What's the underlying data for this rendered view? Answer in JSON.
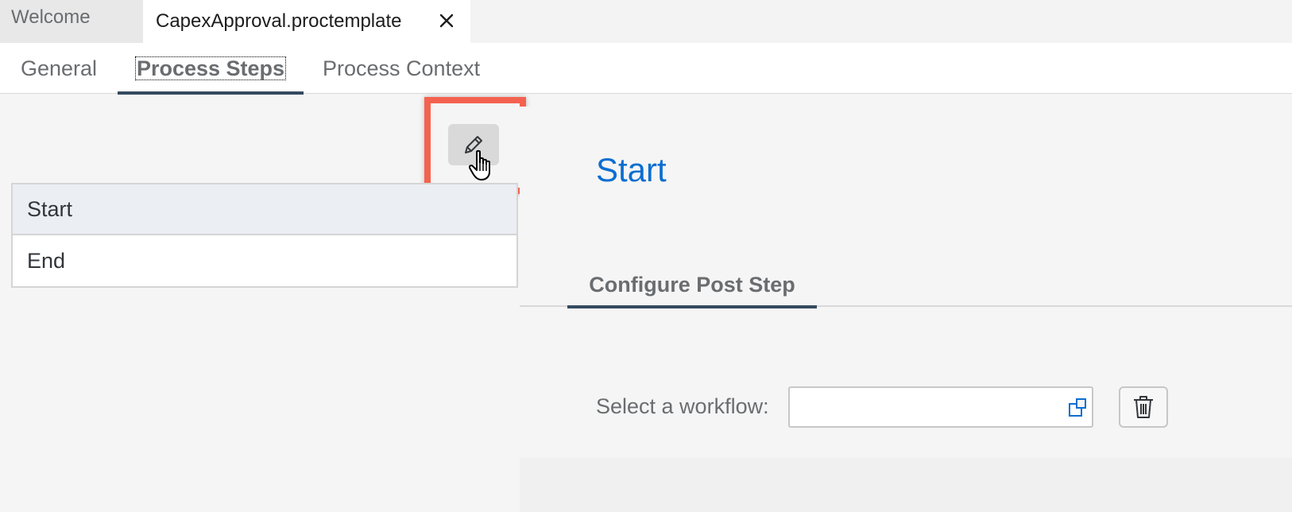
{
  "editor_tabs": [
    {
      "label": "Welcome",
      "active": false
    },
    {
      "label": "CapexApproval.proctemplate",
      "active": true
    }
  ],
  "sub_tabs": {
    "general": "General",
    "process_steps": "Process Steps",
    "process_context": "Process Context",
    "selected": "Process Steps"
  },
  "steps": [
    {
      "label": "Start",
      "selected": true
    },
    {
      "label": "End",
      "selected": false
    }
  ],
  "detail": {
    "title": "Start",
    "tab": "Configure Post Step",
    "workflow_label": "Select a workflow:",
    "workflow_value": ""
  },
  "icons": {
    "edit": "pencil-icon",
    "close": "close-icon",
    "value_help": "value-help-icon",
    "delete": "trash-icon",
    "cursor": "hand-pointer-icon"
  },
  "colors": {
    "accent": "#0a6ed1",
    "tab_indicator": "#354a5f",
    "highlight": "#f4624f"
  }
}
